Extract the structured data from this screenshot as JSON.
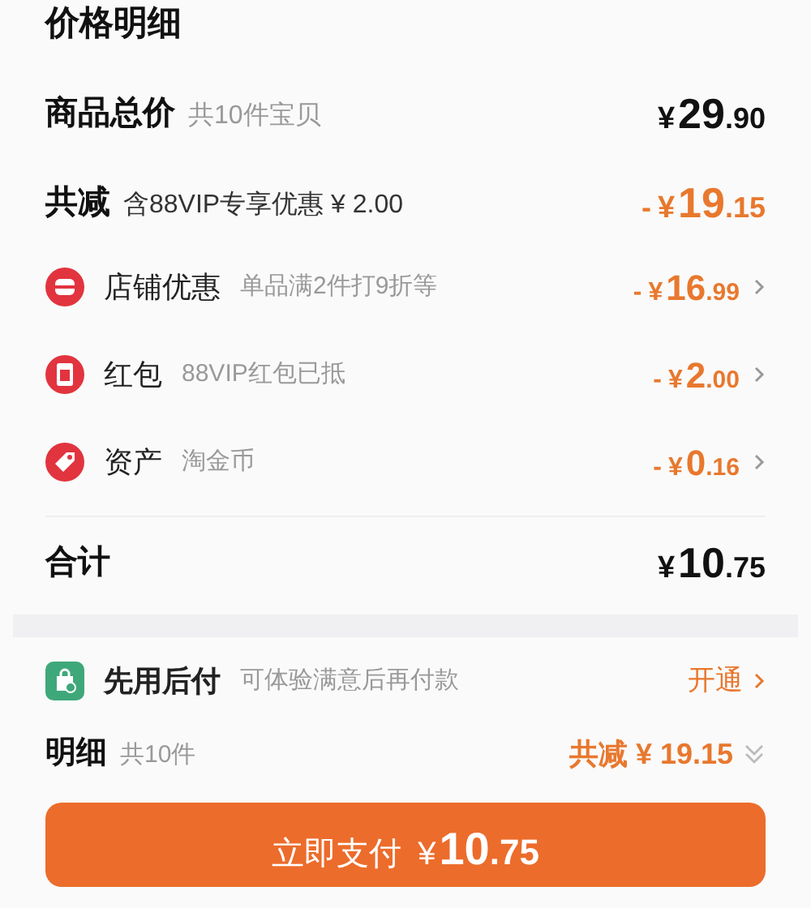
{
  "title": "价格明细",
  "total": {
    "label": "商品总价",
    "note": "共10件宝贝",
    "price": {
      "currency": "¥",
      "whole": "29",
      "fraction": ".90"
    }
  },
  "reduction": {
    "label": "共减",
    "note": "含88VIP专享优惠 ¥ 2.00",
    "price": {
      "sign": "-",
      "currency": "¥",
      "whole": "19",
      "fraction": ".15"
    }
  },
  "discounts": [
    {
      "kind": "store",
      "label": "店铺优惠",
      "note": "单品满2件打9折等",
      "price": {
        "sign": "-",
        "currency": "¥",
        "whole": "16",
        "fraction": ".99"
      }
    },
    {
      "kind": "redpacket",
      "label": "红包",
      "note": "88VIP红包已抵",
      "price": {
        "sign": "-",
        "currency": "¥",
        "whole": "2",
        "fraction": ".00"
      }
    },
    {
      "kind": "tag",
      "label": "资产",
      "note": "淘金币",
      "price": {
        "sign": "-",
        "currency": "¥",
        "whole": "0",
        "fraction": ".16"
      }
    }
  ],
  "sum": {
    "label": "合计",
    "price": {
      "currency": "¥",
      "whole": "10",
      "fraction": ".75"
    }
  },
  "pay_later": {
    "label": "先用后付",
    "note": "可体验满意后再付款",
    "action": "开通"
  },
  "detail": {
    "label": "明细",
    "note": "共10件",
    "summary": "共减 ¥ 19.15"
  },
  "pay_button": {
    "label": "立即支付",
    "currency": "¥",
    "whole": "10",
    "fraction": ".75"
  }
}
